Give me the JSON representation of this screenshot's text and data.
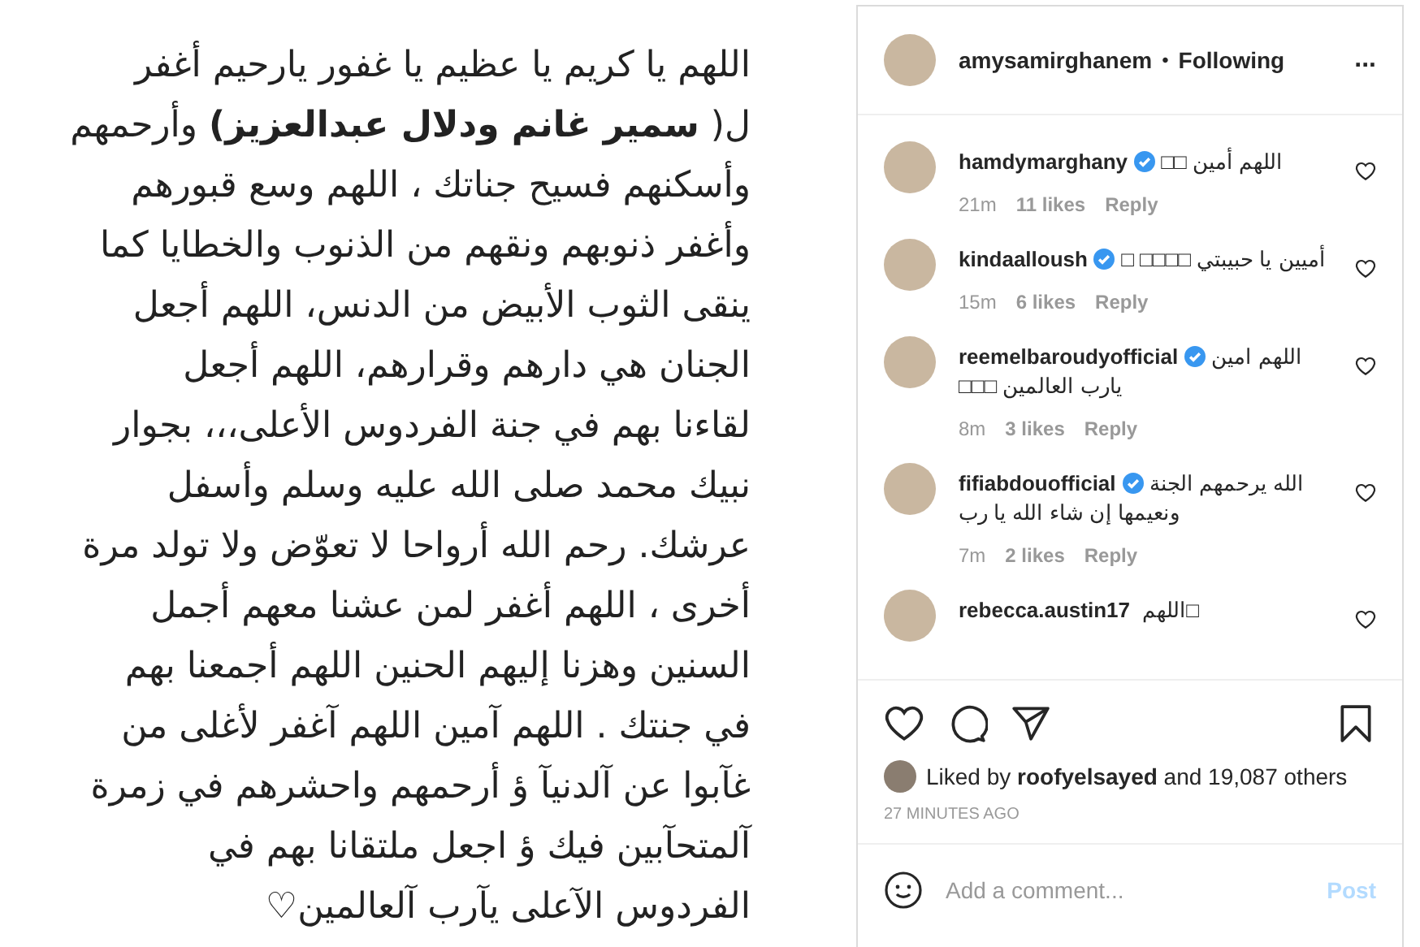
{
  "post_image": {
    "lines": [
      "اللهم يا كريم يا عظيم يا غفور يارحيم أغفر",
      "ل( **سمير غانم ودلال عبدالعزيز)** وأرحمهم",
      "وأسكنهم فسيح جناتك ، اللهم وسع قبورهم",
      "وأغفر ذنوبهم ونقهم من الذنوب والخطايا كما",
      "ينقى الثوب الأبيض من الدنس، اللهم أجعل",
      "الجنان هي دارهم وقرارهم، اللهم أجعل",
      "لقاءنا بهم في جنة الفردوس الأعلى،،، بجوار",
      "نبيك محمد صلى الله عليه وسلم وأسفل",
      "عرشك. رحم الله أرواحا لا تعوّض ولا تولد مرة",
      "أخرى ، اللهم أغفر لمن عشنا معهم أجمل",
      "السنين وهزنا إليهم الحنين اللهم أجمعنا بهم",
      "في جنتك . اللهم آمين اللهم آغفر لأغلى من",
      "غآبوا عن آلدنيآ ؤ أرحمهم واحشرهم في زمرة",
      "آلمتحآبين فيك ؤ اجعل ملتقانا بهم في",
      "الفردوس الآعلى يآرب آلعالمين♡"
    ]
  },
  "header": {
    "username": "amysamirghanem",
    "separator": "•",
    "follow_status": "Following",
    "more": "..."
  },
  "comments": [
    {
      "username": "hamdymarghany",
      "verified": true,
      "text": "اللهم أمين □□",
      "time": "21m",
      "likes": "11 likes",
      "reply": "Reply"
    },
    {
      "username": "kindaalloush",
      "verified": true,
      "text": "أميين يا حبيبتي □□□□ □",
      "time": "15m",
      "likes": "6 likes",
      "reply": "Reply"
    },
    {
      "username": "reemelbaroudyofficial",
      "verified": true,
      "text": "اللهم امين يارب العالمين □□□",
      "time": "8m",
      "likes": "3 likes",
      "reply": "Reply"
    },
    {
      "username": "fifiabdouofficial",
      "verified": true,
      "text": "الله يرحمهم الجنة ونعيمها إن شاء الله يا رب",
      "time": "7m",
      "likes": "2 likes",
      "reply": "Reply"
    },
    {
      "username": "rebecca.austin17",
      "text": "□اللهم"
    }
  ],
  "likes_summary": {
    "prefix": "Liked by",
    "user": "roofyelsayed",
    "suffix": "and 19,087 others"
  },
  "timestamp": "27 MINUTES AGO",
  "comment_box": {
    "placeholder": "Add a comment...",
    "post_button": "Post",
    "post_enabled": false
  }
}
